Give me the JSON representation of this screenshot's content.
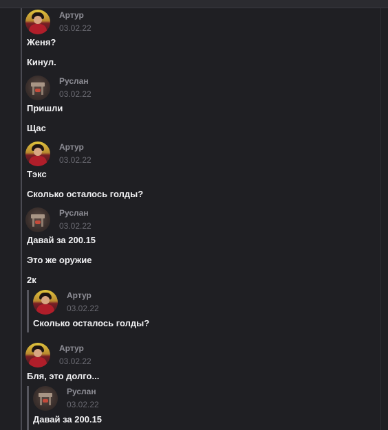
{
  "messages": [
    {
      "author": "Артур",
      "date": "03.02.22",
      "avatar": "artur-avatar",
      "lines": [
        "Женя?",
        "Кинул."
      ]
    },
    {
      "author": "Руслан",
      "date": "03.02.22",
      "avatar": "ruslan-avatar",
      "lines": [
        "Пришли",
        "Щас"
      ]
    },
    {
      "author": "Артур",
      "date": "03.02.22",
      "avatar": "artur-avatar",
      "lines": [
        "Тэкс",
        "Сколько осталось голды?"
      ]
    },
    {
      "author": "Руслан",
      "date": "03.02.22",
      "avatar": "ruslan-avatar",
      "lines": [
        "Давай за 200.15",
        "Это же оружие",
        "2к"
      ],
      "quote": {
        "author": "Артур",
        "date": "03.02.22",
        "text": "Сколько осталось голды?"
      }
    },
    {
      "author": "Артур",
      "date": "03.02.22",
      "avatar": "artur-avatar",
      "lines": [
        "Бля, это долго..."
      ],
      "quote": {
        "author": "Руслан",
        "date": "03.02.22",
        "text": "Давай за 200.15"
      }
    }
  ]
}
